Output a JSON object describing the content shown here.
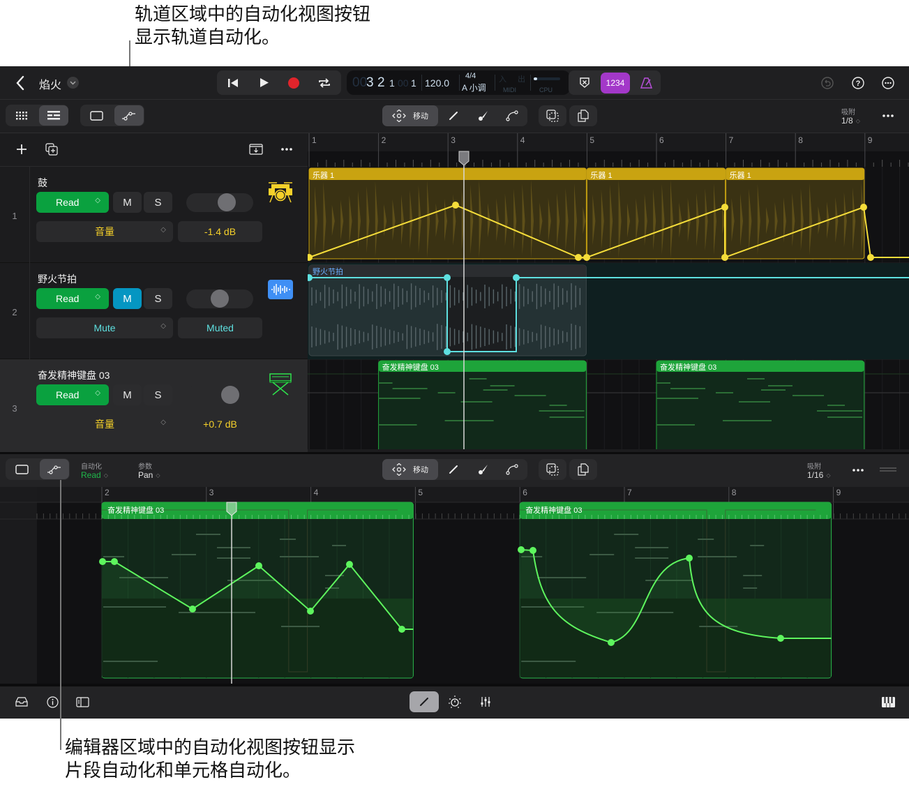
{
  "callouts": {
    "top": [
      "轨道区域中的自动化视图按钮",
      "显示轨道自动化。"
    ],
    "bottom": [
      "编辑器区域中的自动化视图按钮显示",
      "片段自动化和单元格自动化。"
    ]
  },
  "header": {
    "back_icon": "chevron-left-icon",
    "project_name": "焰火",
    "transport": [
      "go-to-beginning-icon",
      "play-icon",
      "record-icon",
      "cycle-icon"
    ],
    "lcd": {
      "position_dim": "00",
      "bar": "3",
      "beat": "2",
      "div": "1",
      "tick_dim": "00",
      "tick": "1",
      "tempo": "120.0",
      "time_signature": "4/4",
      "key": "A 小调",
      "midi_in": "入",
      "midi_out": "出",
      "midi_label": "MIDI",
      "cpu_label": "CPU"
    },
    "count_in_label": "1234",
    "right_icons": [
      "undo-icon",
      "help-icon",
      "more-icon"
    ]
  },
  "tracks_toolbar": {
    "view_buttons": [
      "grid-view-icon",
      "tracks-view-icon"
    ],
    "region_view_icon": "region-view-icon",
    "automation_view_icon": "automation-view-icon",
    "move_label": "移动",
    "tools": [
      "pencil-icon",
      "brush-icon",
      "curve-icon"
    ],
    "actions": [
      "select-icon",
      "copy-icon"
    ],
    "snap_label": "吸附",
    "snap_value": "1/8"
  },
  "track_list_header": {
    "icons": [
      "add-track-icon",
      "duplicate-track-icon",
      "import-icon",
      "more-icon"
    ]
  },
  "tracks": [
    {
      "number": "1",
      "name": "鼓",
      "mode": "Read",
      "mute": "M",
      "solo": "S",
      "param": "音量",
      "value": "-1.4 dB",
      "muted": false,
      "pan_fraction": 0.6,
      "icon": "drum-kit-icon",
      "accent": "#f5d02a"
    },
    {
      "number": "2",
      "name": "野火节拍",
      "mode": "Read",
      "mute": "M",
      "solo": "S",
      "param": "Mute",
      "value": "Muted",
      "muted": true,
      "pan_fraction": 0.5,
      "icon": "audio-waveform-icon",
      "accent": "#5ee0e0"
    },
    {
      "number": "3",
      "name": "奋发精神键盘 03",
      "mode": "Read",
      "mute": "M",
      "solo": "S",
      "param": "音量",
      "value": "+0.7 dB",
      "muted": false,
      "pan_fraction": 0.66,
      "icon": "keyboard-stand-icon",
      "accent": "#f5d02a"
    }
  ],
  "ruler": {
    "bars": [
      "1",
      "2",
      "3",
      "4",
      "5",
      "6",
      "7",
      "8",
      "9"
    ]
  },
  "regions": {
    "drums": [
      {
        "name": "乐器 1"
      },
      {
        "name": "乐器 1"
      },
      {
        "name": "乐器 1"
      }
    ],
    "beat": {
      "name": "野火节拍"
    },
    "keys": [
      {
        "name": "奋发精神键盘 03"
      },
      {
        "name": "奋发精神键盘 03"
      }
    ]
  },
  "editor_toolbar": {
    "automation_label": "自动化",
    "automation_value": "Read",
    "param_label": "参数",
    "param_value": "Pan",
    "move_label": "移动",
    "snap_label": "吸附",
    "snap_value": "1/16"
  },
  "editor_ruler": {
    "bars": [
      "2",
      "3",
      "4",
      "5",
      "6",
      "7",
      "8",
      "9"
    ]
  },
  "editor_regions": [
    {
      "name": "奋发精神键盘 03"
    },
    {
      "name": "奋发精神键盘 03"
    }
  ],
  "bottom_bar": {
    "left_icons": [
      "library-icon",
      "info-icon",
      "inspector-icon"
    ],
    "center_icons": [
      "pencil-icon",
      "smart-controls-icon",
      "mixer-icon"
    ],
    "right_icon": "piano-keys-icon"
  }
}
